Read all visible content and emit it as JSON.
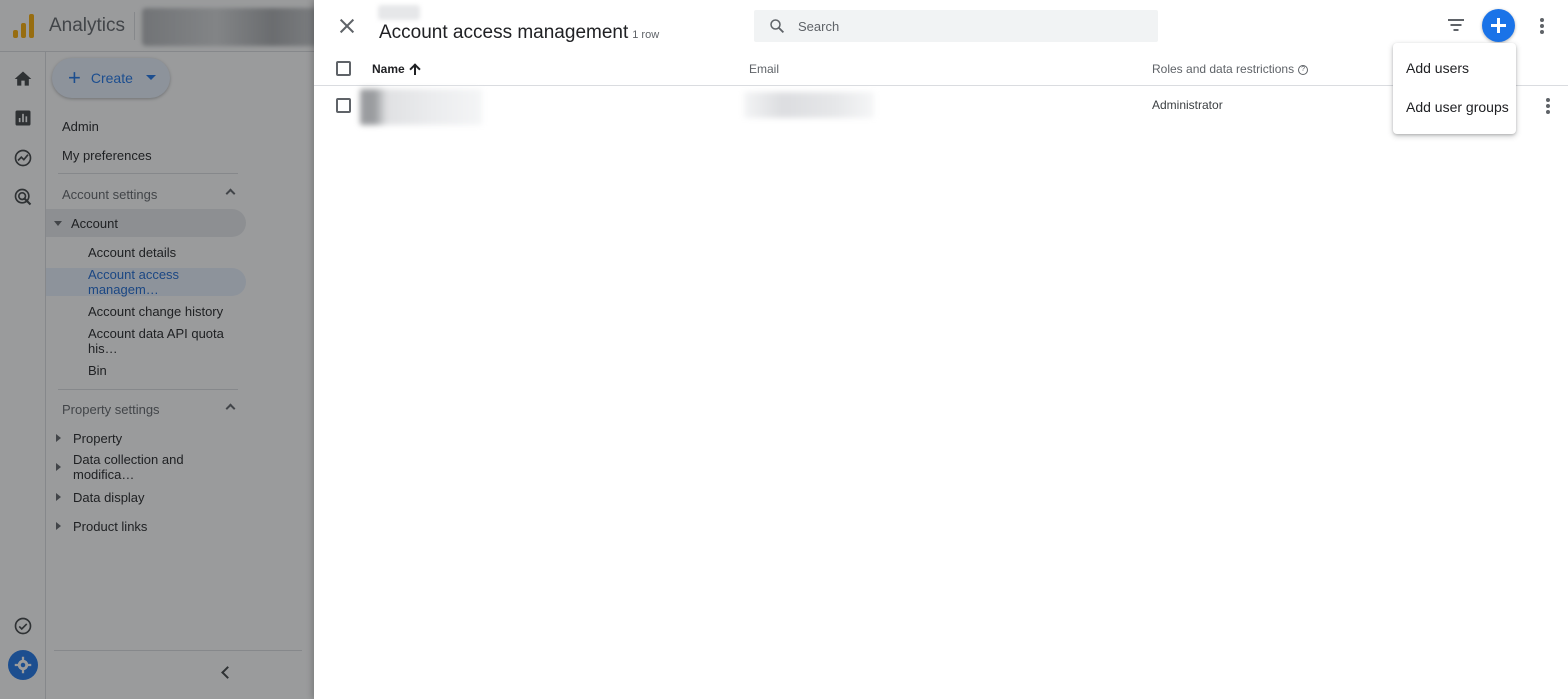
{
  "app": {
    "title": "Analytics"
  },
  "nav": {
    "create_label": "Create",
    "admin": "Admin",
    "my_preferences": "My preferences",
    "account_settings": {
      "title": "Account settings",
      "group": "Account",
      "items": [
        "Account details",
        "Account access managem…",
        "Account change history",
        "Account data API quota his…",
        "Bin"
      ]
    },
    "property_settings": {
      "title": "Property settings",
      "items": [
        "Property",
        "Data collection and modifica…",
        "Data display",
        "Product links"
      ]
    }
  },
  "panel": {
    "title": "Account access management",
    "count": "1 row",
    "search_placeholder": "Search",
    "columns": {
      "name": "Name",
      "email": "Email",
      "roles": "Roles and data restrictions"
    },
    "rows": [
      {
        "role": "Administrator"
      }
    ]
  },
  "menu": {
    "items": [
      "Add users",
      "Add user groups"
    ]
  },
  "colors": {
    "accent": "#1a73e8",
    "logo": "#f9ab00",
    "selected_bg": "#e8f0fe"
  }
}
